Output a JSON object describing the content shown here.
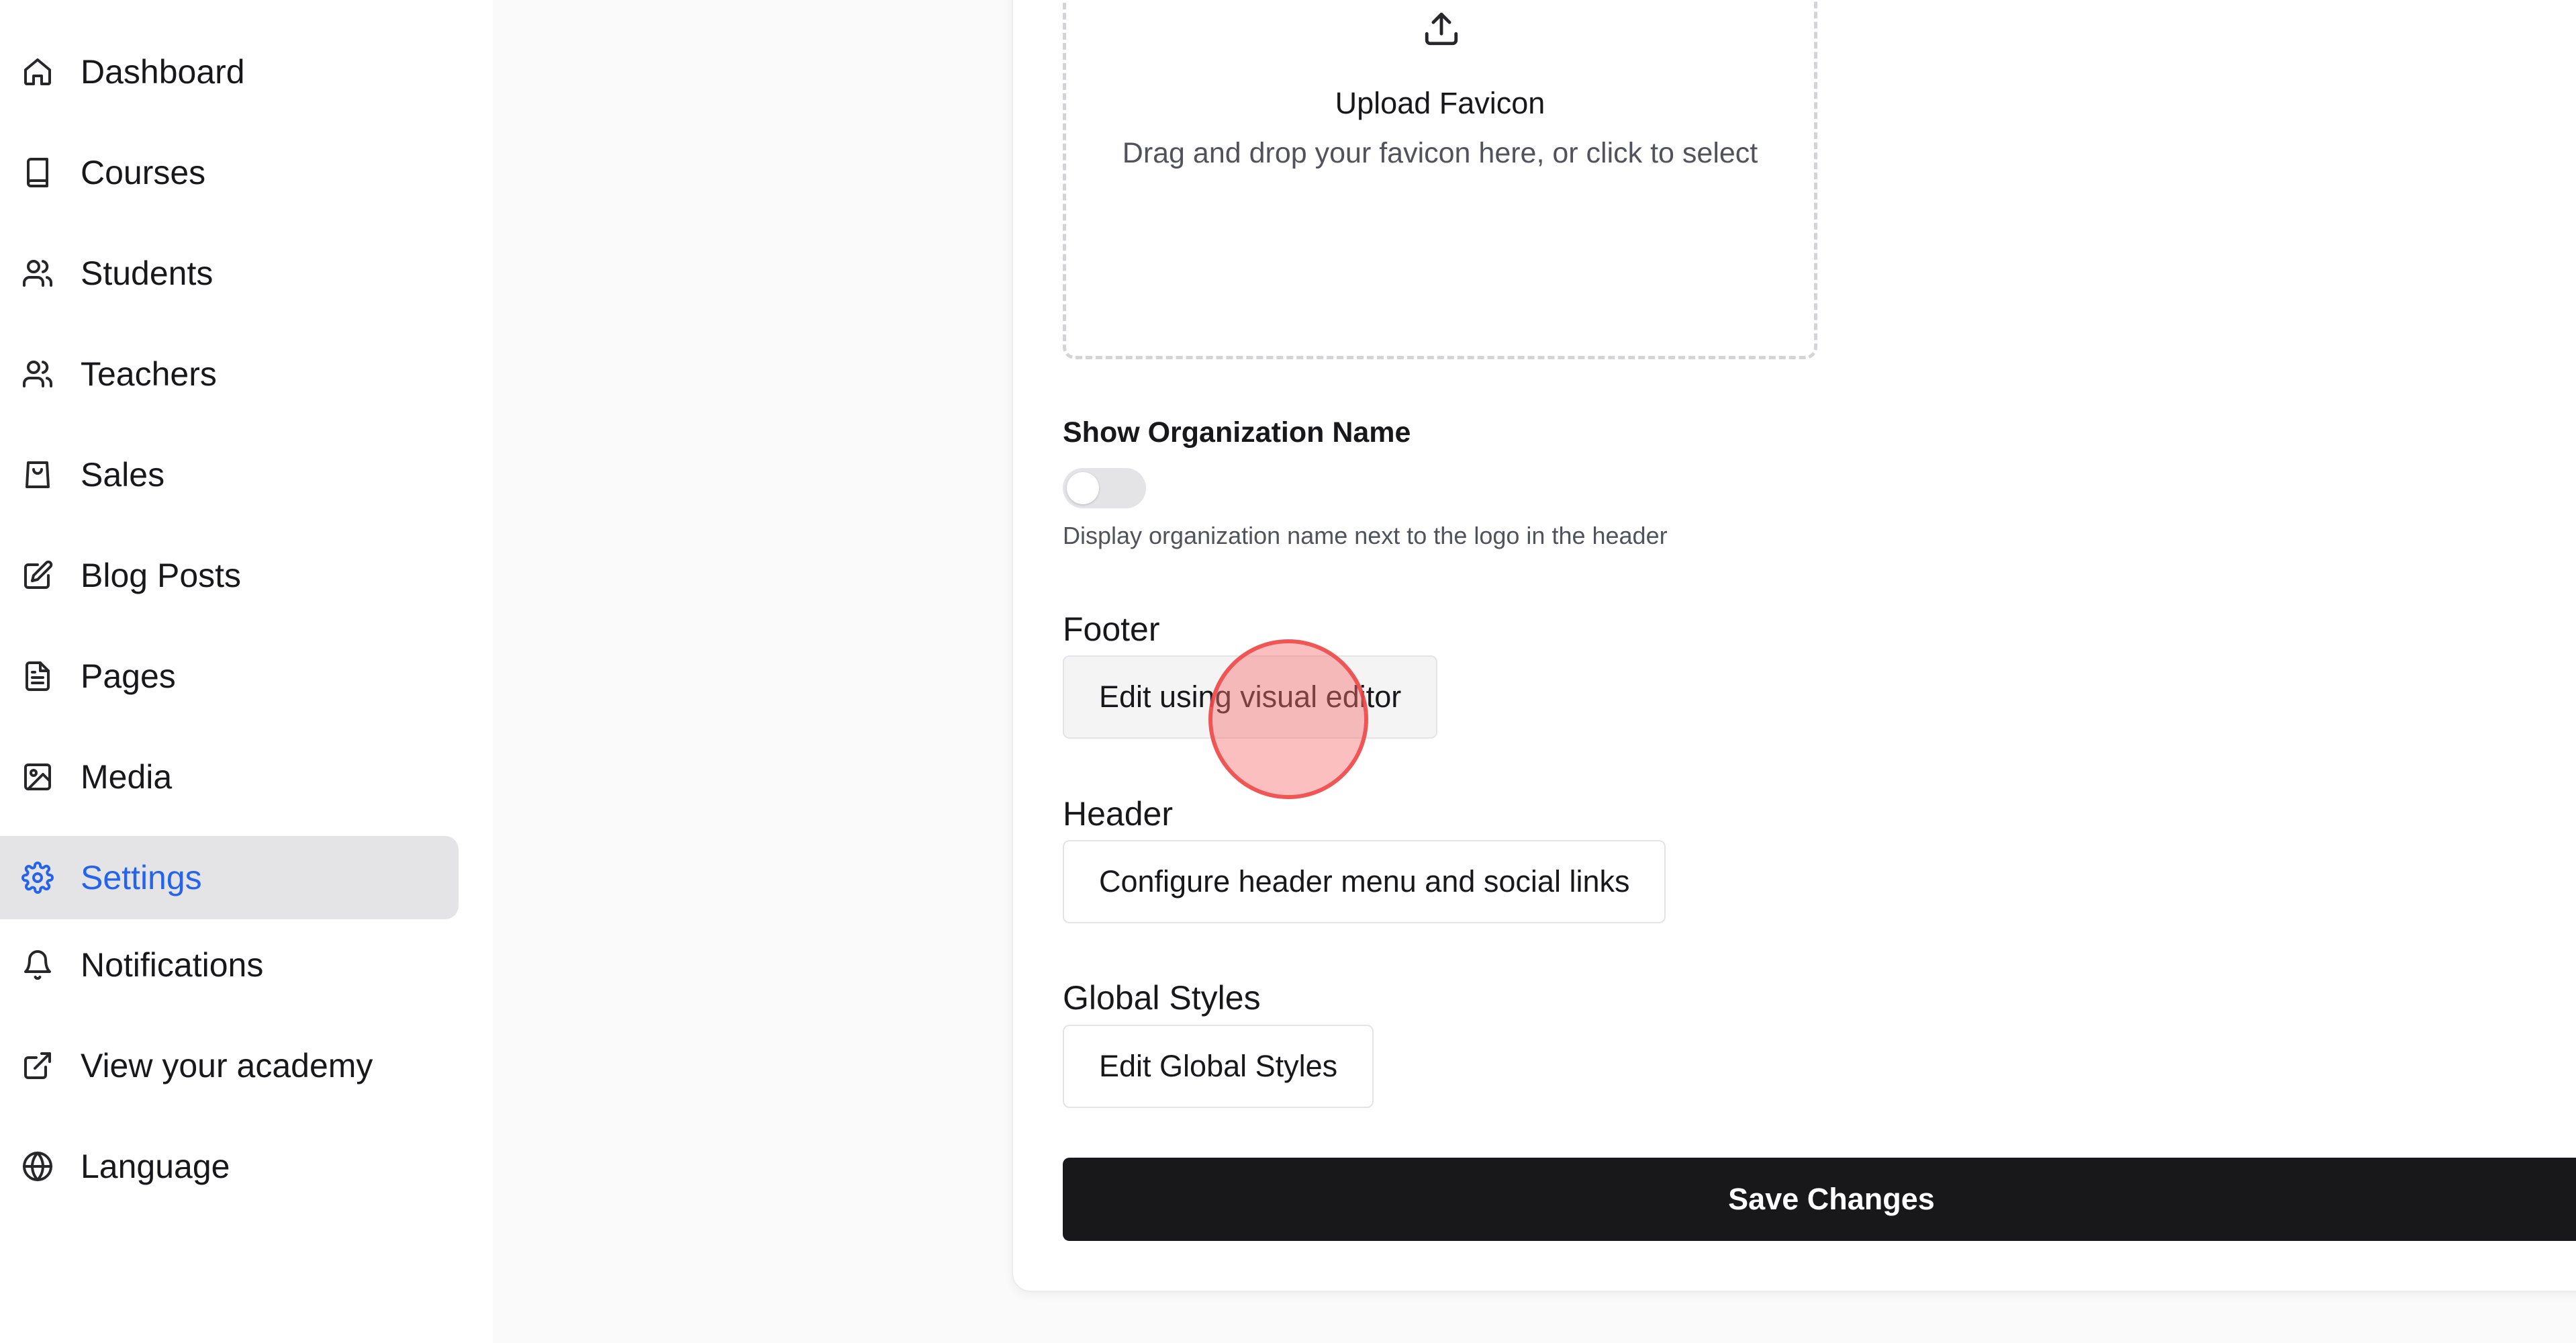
{
  "sidebar": {
    "items": [
      {
        "label": "Dashboard",
        "icon": "home-icon"
      },
      {
        "label": "Courses",
        "icon": "book-icon"
      },
      {
        "label": "Students",
        "icon": "users-icon"
      },
      {
        "label": "Teachers",
        "icon": "users-icon"
      },
      {
        "label": "Sales",
        "icon": "shopping-bag-icon"
      },
      {
        "label": "Blog Posts",
        "icon": "edit-icon"
      },
      {
        "label": "Pages",
        "icon": "file-text-icon"
      },
      {
        "label": "Media",
        "icon": "image-icon"
      },
      {
        "label": "Settings",
        "icon": "gear-icon",
        "active": true
      },
      {
        "label": "Notifications",
        "icon": "bell-icon"
      },
      {
        "label": "View your academy",
        "icon": "external-link-icon"
      },
      {
        "label": "Language",
        "icon": "globe-icon"
      }
    ]
  },
  "main": {
    "favicon_upload": {
      "icon": "upload-icon",
      "title": "Upload Favicon",
      "description": "Drag and drop your favicon here, or click to select"
    },
    "show_org_name": {
      "label": "Show Organization Name",
      "enabled": false,
      "help": "Display organization name next to the logo in the header"
    },
    "footer": {
      "title": "Footer",
      "button_label": "Edit using visual editor"
    },
    "header": {
      "title": "Header",
      "button_label": "Configure header menu and social links"
    },
    "global_styles": {
      "title": "Global Styles",
      "button_label": "Edit Global Styles"
    },
    "save_label": "Save Changes"
  },
  "colors": {
    "accent": "#2563eb",
    "primary_button": "#18181b",
    "active_nav_bg": "#e4e4e7",
    "click_indicator": "#ef4444"
  }
}
